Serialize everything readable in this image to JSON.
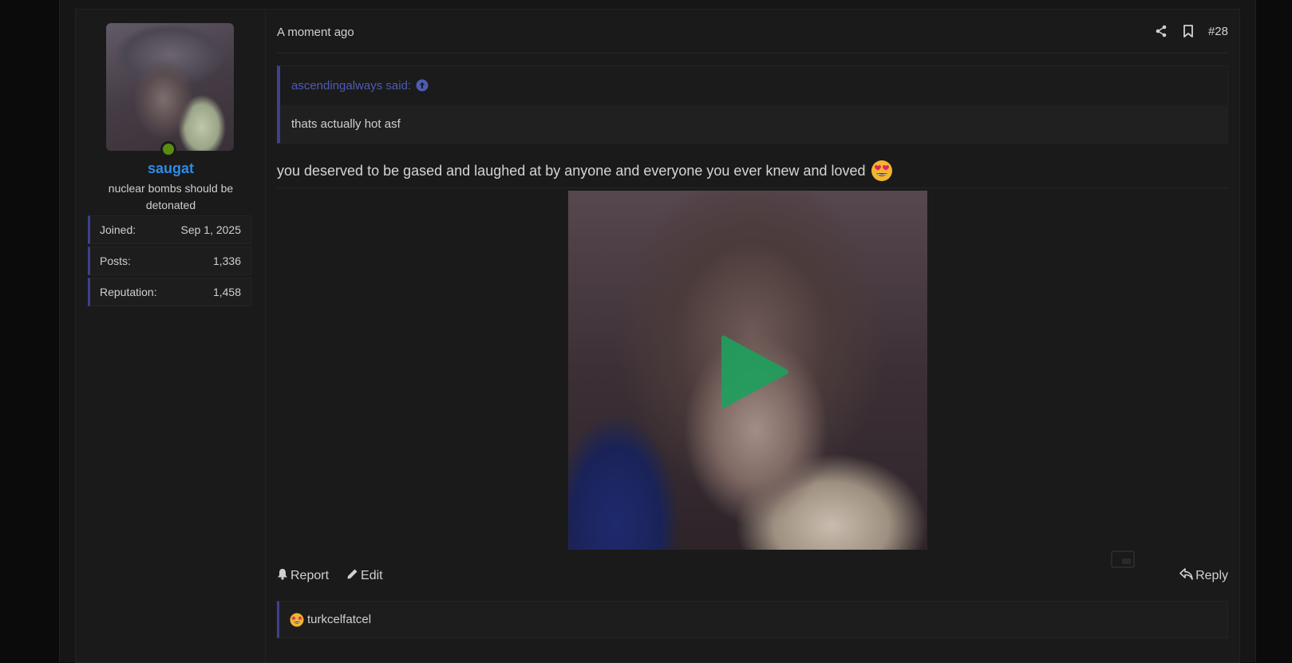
{
  "post": {
    "time": "A moment ago",
    "number": "#28",
    "icons": {
      "share": "share-icon",
      "bookmark": "bookmark-icon",
      "quote_arrow": "arrow-up-circle-icon",
      "play": "play-icon",
      "pip": "picture-in-picture-icon",
      "report": "bell-icon",
      "edit": "pencil-icon",
      "reply": "reply-icon",
      "emoji": "heart-eyes-emoji-icon",
      "reaction": "star-struck-emoji-icon"
    }
  },
  "user": {
    "name": "saugat",
    "title": "nuclear bombs should be detonated",
    "online": true,
    "extras": [
      {
        "label": "Joined:",
        "value": "Sep 1, 2025"
      },
      {
        "label": "Posts:",
        "value": "1,336"
      },
      {
        "label": "Reputation:",
        "value": "1,458"
      }
    ]
  },
  "quote": {
    "author": "ascendingalways said:",
    "text": "thats actually hot asf"
  },
  "message": {
    "text": "you deserved to be gased and laughed at by anyone and everyone you ever knew and loved"
  },
  "actions": {
    "report": "Report",
    "edit": "Edit",
    "reply": "Reply"
  },
  "reactions": {
    "users": "turkcelfatcel"
  },
  "colors": {
    "accent": "#3e418f",
    "username": "#2f8be6",
    "play": "#1f9e5c",
    "online": "#5a8c12",
    "quote_link": "#4e5bb3"
  }
}
